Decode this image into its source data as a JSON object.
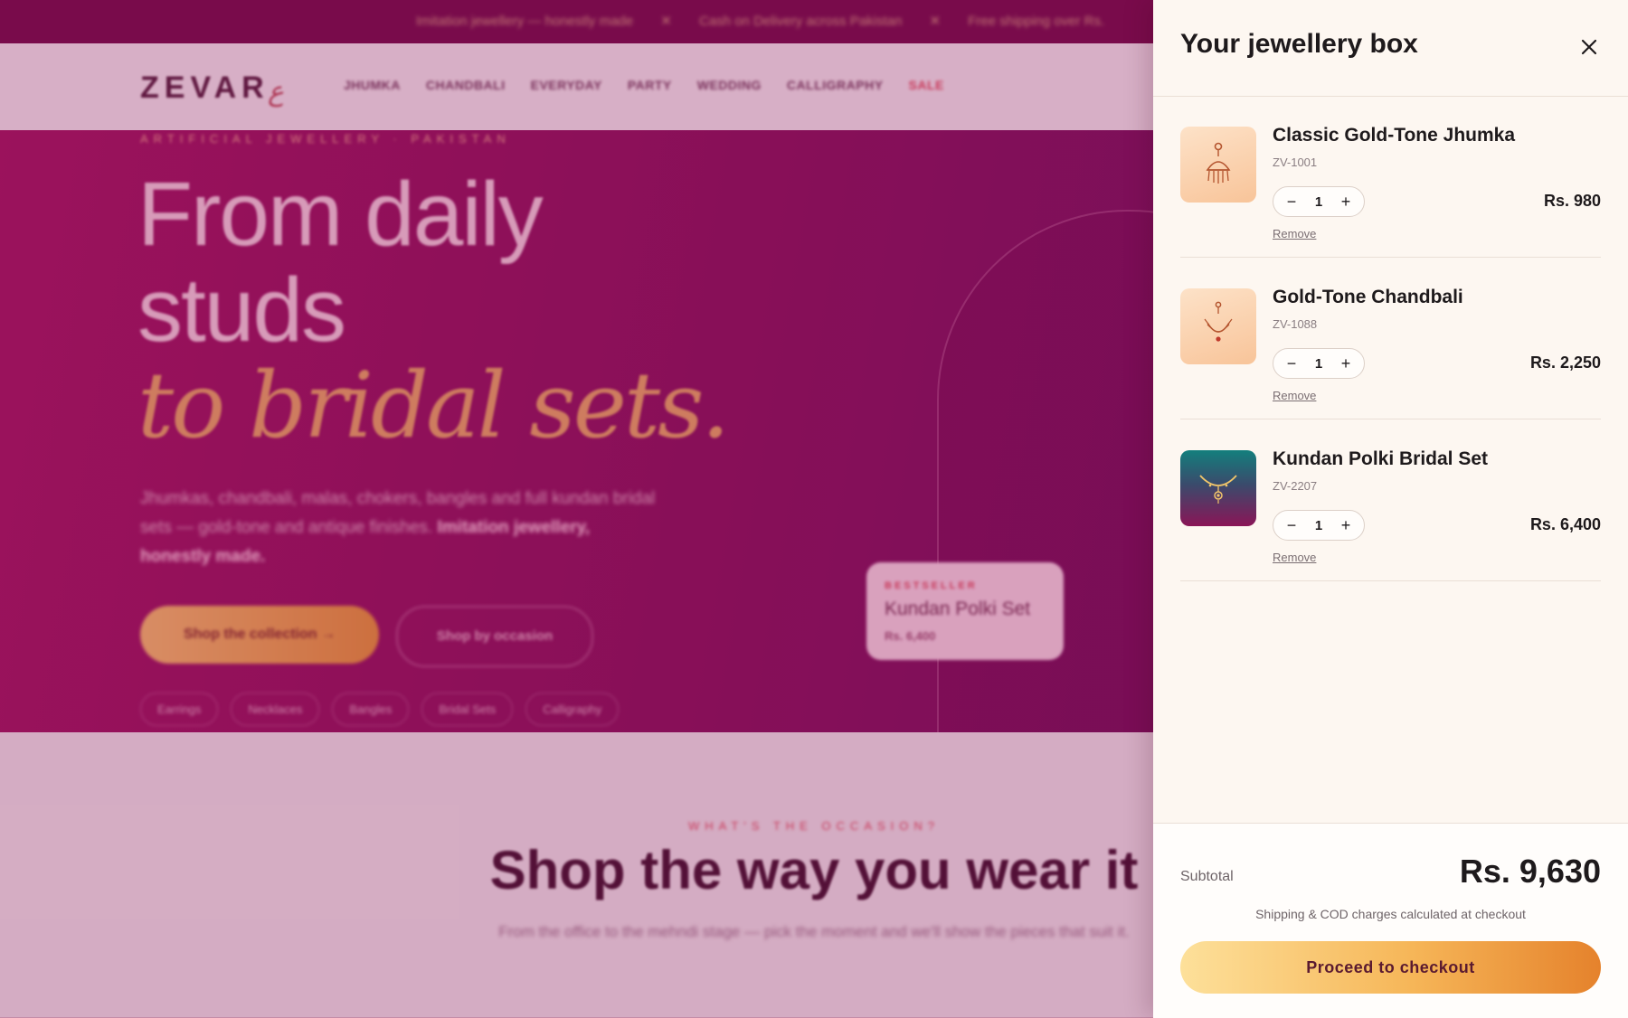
{
  "announcement": {
    "messages": [
      "Imitation jewellery — honestly made",
      "✕",
      "Cash on Delivery across Pakistan",
      "✕",
      "Free shipping over Rs."
    ]
  },
  "header": {
    "logo": "ZEVAR",
    "nav": [
      "JHUMKA",
      "CHANDBALI",
      "EVERYDAY",
      "PARTY",
      "WEDDING",
      "CALLIGRAPHY",
      "SALE"
    ]
  },
  "hero": {
    "kicker": "ARTIFICIAL JEWELLERY · PAKISTAN",
    "title_line1": "From daily",
    "title_line2": "studs",
    "title_italic": "to bridal sets.",
    "subtitle": "Jhumkas, chandbali, malas, chokers, bangles and full kundan bridal sets — gold-tone and antique finishes.",
    "subtitle_bold": "Imitation jewellery, honestly made.",
    "primary_button": "Shop the collection →",
    "secondary_button": "Shop by occasion",
    "chips": [
      "Earrings",
      "Necklaces",
      "Bangles",
      "Bridal Sets",
      "Calligraphy"
    ],
    "card": {
      "kicker": "BESTSELLER",
      "title": "Kundan Polki Set",
      "price": "Rs. 6,400"
    }
  },
  "occasion": {
    "kicker": "WHAT'S THE OCCASION?",
    "title": "Shop the way you wear it",
    "text": "From the office to the mehndi stage — pick the moment and we'll show the pieces that suit it."
  },
  "cart": {
    "title": "Your jewellery box",
    "items": [
      {
        "name": "Classic Gold-Tone Jhumka",
        "sku": "ZV-1001",
        "qty": "1",
        "price": "Rs. 980",
        "remove": "Remove",
        "thumb": "jhumka-icon"
      },
      {
        "name": "Gold-Tone Chandbali",
        "sku": "ZV-1088",
        "qty": "1",
        "price": "Rs. 2,250",
        "remove": "Remove",
        "thumb": "chandbali-icon"
      },
      {
        "name": "Kundan Polki Bridal Set",
        "sku": "ZV-2207",
        "qty": "1",
        "price": "Rs. 6,400",
        "remove": "Remove",
        "thumb": "necklace-icon"
      }
    ],
    "subtotal_label": "Subtotal",
    "subtotal_value": "Rs. 9,630",
    "shipping_note": "Shipping & COD charges calculated at checkout",
    "checkout_label": "Proceed to checkout"
  },
  "colors": {
    "hero_magenta": "#8d0f5a",
    "accent_gold": "#f6b658",
    "drawer_bg": "#fdf7f1"
  }
}
